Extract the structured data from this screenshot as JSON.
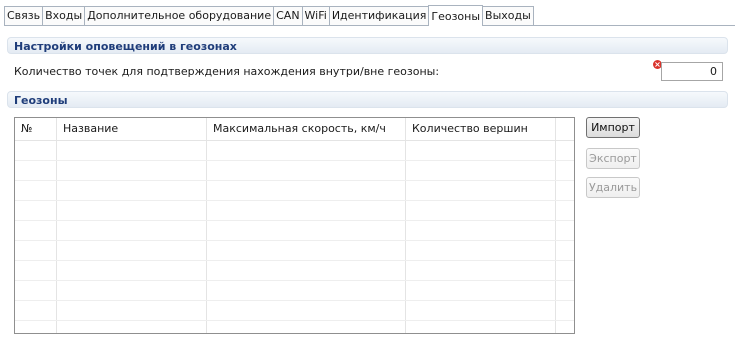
{
  "tabs": [
    {
      "label": "Связь"
    },
    {
      "label": "Входы"
    },
    {
      "label": "Дополнительное оборудование"
    },
    {
      "label": "CAN"
    },
    {
      "label": "WiFi"
    },
    {
      "label": "Идентификация"
    },
    {
      "label": "Геозоны",
      "active": true
    },
    {
      "label": "Выходы"
    }
  ],
  "notify_section": {
    "title": "Настройки оповещений в геозонах",
    "confirm_points_label": "Количество точек для подтверждения нахождения внутри/вне геозоны:",
    "confirm_points_value": "0",
    "error_icon": "error-x-icon"
  },
  "geozones_section": {
    "title": "Геозоны",
    "columns": [
      "№",
      "Название",
      "Максимальная скорость, км/ч",
      "Количество вершин"
    ],
    "rows": []
  },
  "buttons": {
    "import": "Импорт",
    "export": "Экспорт",
    "delete": "Удалить"
  }
}
